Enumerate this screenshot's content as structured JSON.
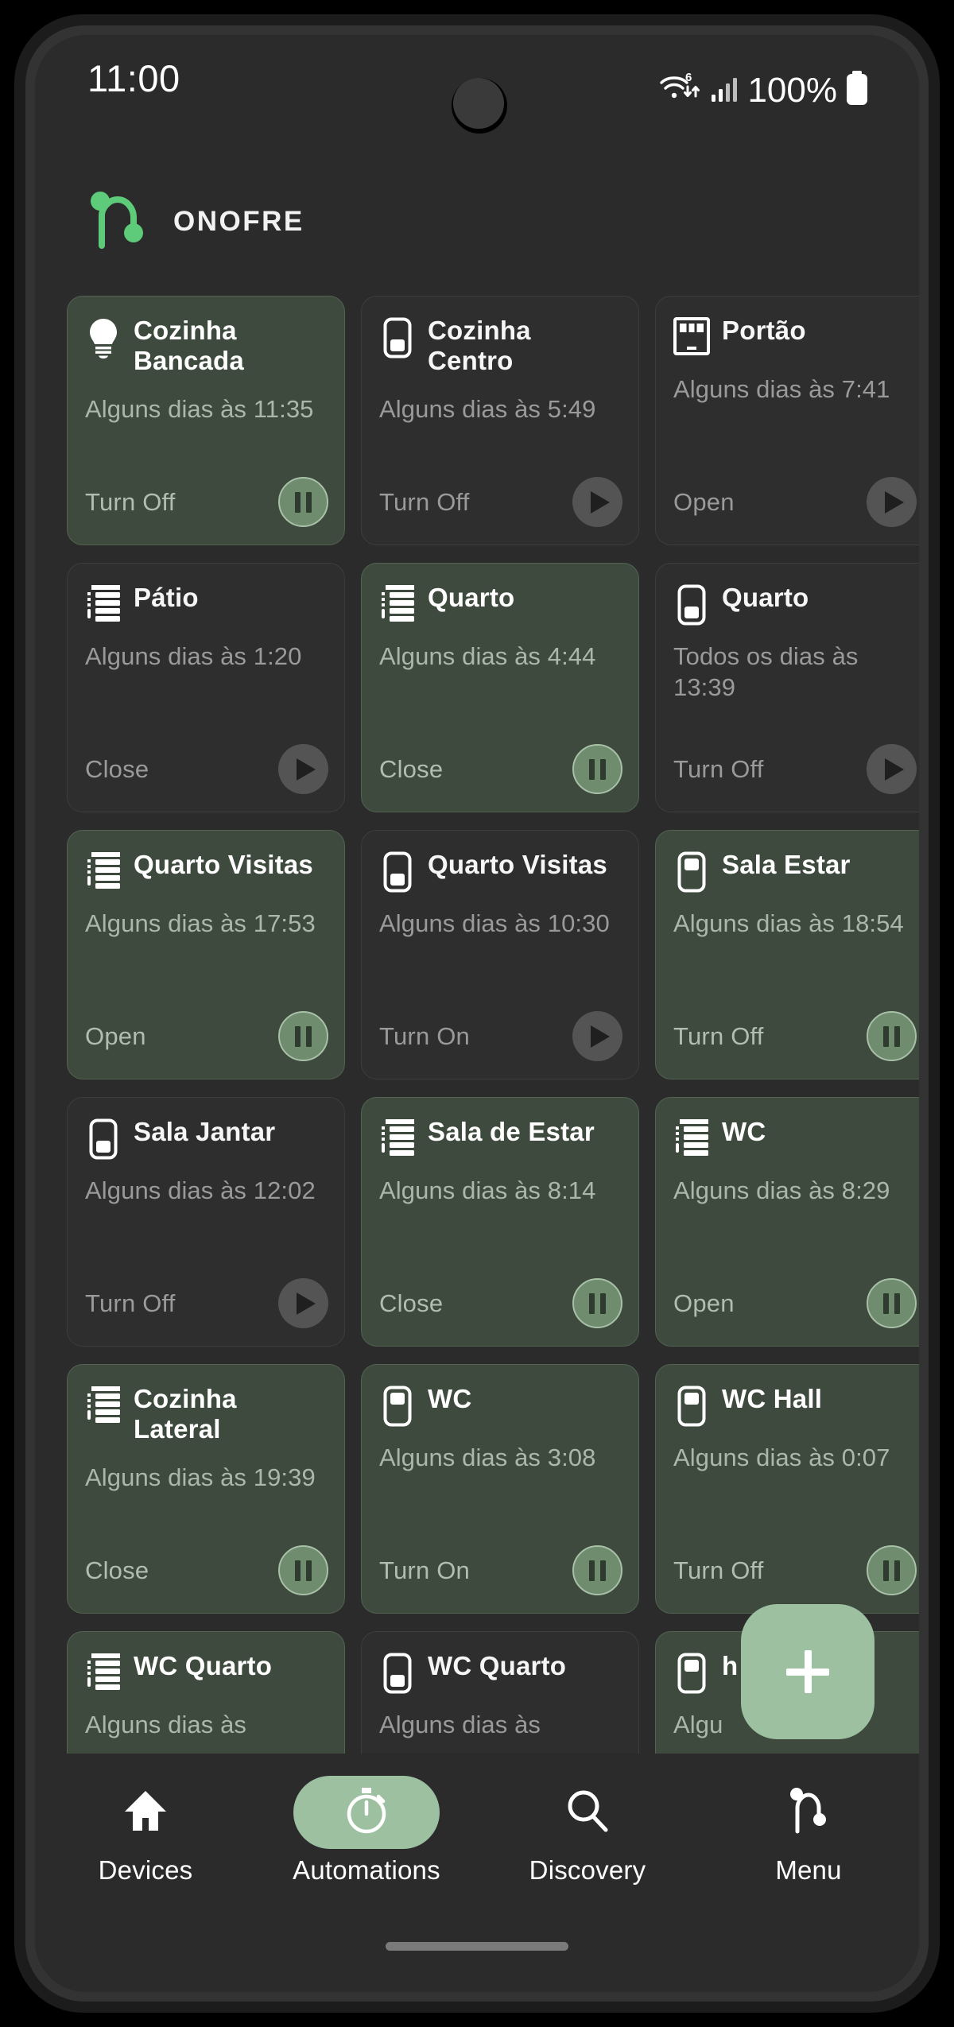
{
  "status_bar": {
    "time": "11:00",
    "battery_percent": "100%",
    "wifi_icon": "wifi-6-icon",
    "signal_icon": "cellular-signal-icon",
    "battery_icon": "battery-full-icon"
  },
  "brand": {
    "name": "ONOFRE",
    "logo_icon": "onofre-logo-icon",
    "accent_color": "#5ecb7a"
  },
  "theme": {
    "active_card_bg": "#3d4a3d",
    "inactive_card_bg": "#2e2e2e",
    "accent_green": "#9dc0a0",
    "pause_button_bg": "#6f8c6f",
    "play_button_bg": "#545454",
    "screen_bg": "#2b2b2b"
  },
  "fab": {
    "label": "+",
    "icon": "plus-icon"
  },
  "automations": [
    {
      "title": "Cozinha Bancada",
      "schedule": "Alguns dias às 11:35",
      "action": "Turn Off",
      "state": "active",
      "icon": "lightbulb-icon",
      "control": "pause-icon"
    },
    {
      "title": "Cozinha Centro",
      "schedule": "Alguns dias às 5:49",
      "action": "Turn Off",
      "state": "inactive",
      "icon": "switch-icon",
      "control": "play-icon"
    },
    {
      "title": "Portão",
      "schedule": "Alguns dias às 7:41",
      "action": "Open",
      "state": "inactive",
      "icon": "garage-door-icon",
      "control": "play-icon"
    },
    {
      "title": "Pátio",
      "schedule": "Alguns dias às 1:20",
      "action": "Close",
      "state": "inactive",
      "icon": "blinds-icon",
      "control": "play-icon"
    },
    {
      "title": "Quarto",
      "schedule": "Alguns dias às 4:44",
      "action": "Close",
      "state": "active",
      "icon": "blinds-icon",
      "control": "pause-icon"
    },
    {
      "title": "Quarto",
      "schedule": "Todos os dias às 13:39",
      "action": "Turn Off",
      "state": "inactive",
      "icon": "switch-icon",
      "control": "play-icon"
    },
    {
      "title": "Quarto Visitas",
      "schedule": "Alguns dias às 17:53",
      "action": "Open",
      "state": "active",
      "icon": "blinds-icon",
      "control": "pause-icon"
    },
    {
      "title": "Quarto Visitas",
      "schedule": "Alguns dias às 10:30",
      "action": "Turn On",
      "state": "inactive",
      "icon": "switch-icon",
      "control": "play-icon"
    },
    {
      "title": "Sala Estar",
      "schedule": "Alguns dias às 18:54",
      "action": "Turn Off",
      "state": "active",
      "icon": "switch-on-icon",
      "control": "pause-icon"
    },
    {
      "title": "Sala Jantar",
      "schedule": "Alguns dias às 12:02",
      "action": "Turn Off",
      "state": "inactive",
      "icon": "switch-icon",
      "control": "play-icon"
    },
    {
      "title": "Sala de Estar",
      "schedule": "Alguns dias às 8:14",
      "action": "Close",
      "state": "active",
      "icon": "blinds-icon",
      "control": "pause-icon"
    },
    {
      "title": "WC",
      "schedule": "Alguns dias às 8:29",
      "action": "Open",
      "state": "active",
      "icon": "blinds-icon",
      "control": "pause-icon"
    },
    {
      "title": "Cozinha Lateral",
      "schedule": "Alguns dias às 19:39",
      "action": "Close",
      "state": "active",
      "icon": "blinds-icon",
      "control": "pause-icon"
    },
    {
      "title": "WC",
      "schedule": "Alguns dias às 3:08",
      "action": "Turn On",
      "state": "active",
      "icon": "switch-on-icon",
      "control": "pause-icon"
    },
    {
      "title": "WC Hall",
      "schedule": "Alguns dias às 0:07",
      "action": "Turn Off",
      "state": "active",
      "icon": "switch-on-icon",
      "control": "pause-icon"
    },
    {
      "title": "WC Quarto",
      "schedule": "Alguns dias às",
      "action": "",
      "state": "active",
      "icon": "blinds-icon",
      "control": ""
    },
    {
      "title": "WC Quarto",
      "schedule": "Alguns dias às",
      "action": "",
      "state": "inactive",
      "icon": "switch-icon",
      "control": ""
    },
    {
      "title": "h",
      "schedule": "Algu",
      "action": "",
      "state": "active",
      "icon": "switch-on-icon",
      "control": ""
    }
  ],
  "bottom_nav": {
    "items": [
      {
        "label": "Devices",
        "icon": "home-icon",
        "selected": false
      },
      {
        "label": "Automations",
        "icon": "stopwatch-icon",
        "selected": true
      },
      {
        "label": "Discovery",
        "icon": "search-icon",
        "selected": false
      },
      {
        "label": "Menu",
        "icon": "onofre-logo-icon",
        "selected": false
      }
    ]
  }
}
